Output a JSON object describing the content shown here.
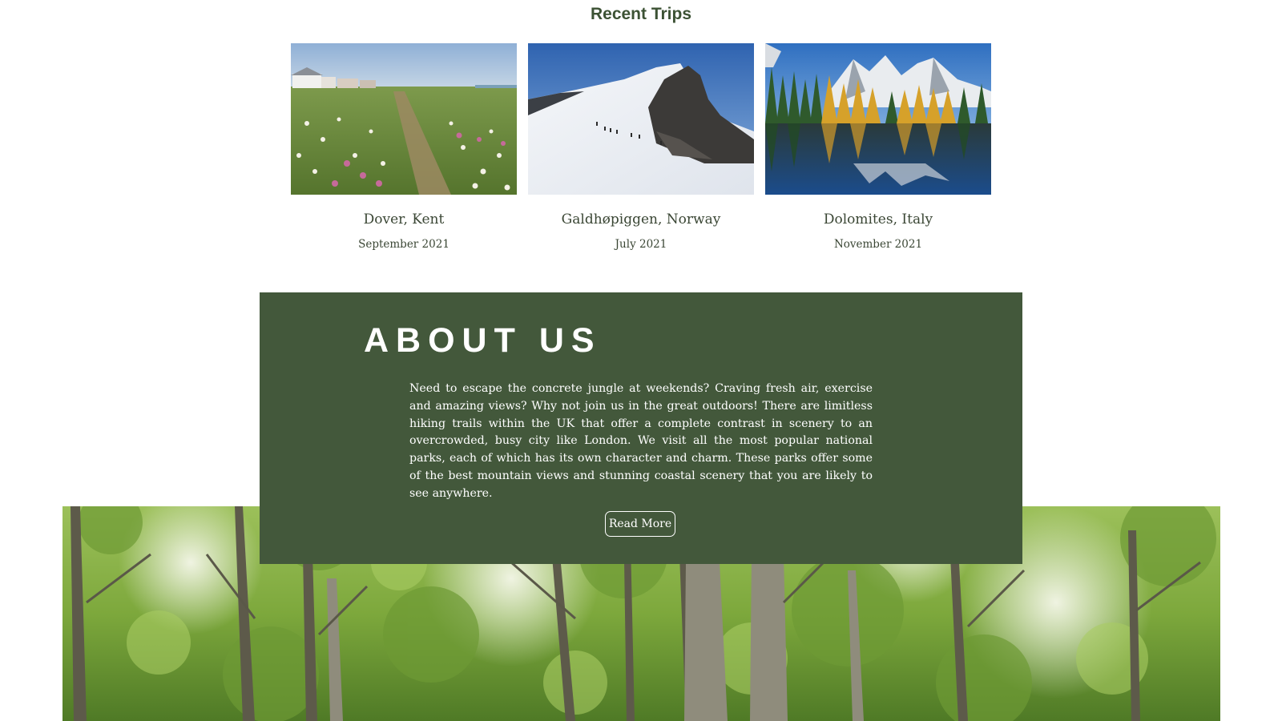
{
  "recent_trips": {
    "heading": "Recent Trips",
    "cards": [
      {
        "name": "Dover, Kent",
        "date": "September 2021",
        "photo": "coastal-meadow-photo"
      },
      {
        "name": "Galdhøpiggen, Norway",
        "date": "July 2021",
        "photo": "snowy-mountain-photo"
      },
      {
        "name": "Dolomites, Italy",
        "date": "November 2021",
        "photo": "alpine-lake-photo"
      }
    ]
  },
  "about": {
    "title": "ABOUT US",
    "body": "Need to escape the concrete jungle at weekends? Craving fresh air, exercise and amazing views? Why not join us in the great outdoors! There are limitless hiking trails within the UK that offer a complete contrast in scenery to an overcrowded, busy city like London. We visit all the most popular national parks, each of which has its own character and charm. These parks offer some of the best mountain views and stunning coastal scenery that you are likely to see anywhere.",
    "button_label": "Read More"
  },
  "colors": {
    "panel_green": "#43583b",
    "heading_green": "#3c5234",
    "text_dark": "#3a4634"
  }
}
